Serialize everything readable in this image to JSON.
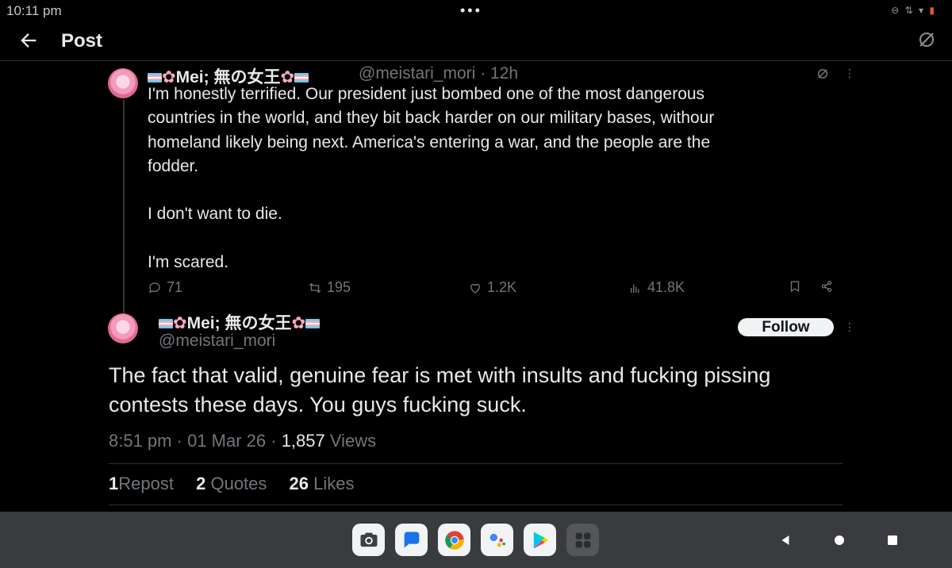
{
  "status_bar": {
    "time": "10:11 pm"
  },
  "header": {
    "title": "Post"
  },
  "reply": {
    "display_name": "Mei; 無の女王",
    "handle": "@meistari_mori",
    "time_ago": "· 12h",
    "text": "I'm honestly terrified. Our president just bombed one of the most dangerous\ncountries in the world, and they bit back harder on our military bases, withour\nhomeland likely being next. America's entering a war, and the people are the\nfodder.\n\nI don't want to die.\n\nI'm scared.",
    "replies": "71",
    "reposts": "195",
    "likes": "1.2K",
    "views": "41.8K"
  },
  "main_post": {
    "display_name": "Mei; 無の女王",
    "handle": "@meistari_mori",
    "follow_label": "Follow",
    "text": "The fact that valid, genuine fear is met with insults and fucking pissing contests these days. You guys fucking suck.",
    "time": "8:51 pm",
    "date": "01 Mar 26",
    "views_count": "1,857",
    "views_label": "Views",
    "reposts_count": "1",
    "reposts_label": "Repost",
    "quotes_count": "2",
    "quotes_label": "Quotes",
    "likes_count": "26",
    "likes_label": "Likes"
  },
  "taskbar_apps": [
    "camera-app",
    "messages-app",
    "chrome-app",
    "assistant-app",
    "play-store-app",
    "app-drawer"
  ],
  "colors": {
    "background": "#000000",
    "text": "#e7e9ea",
    "muted": "#71767b",
    "divider": "#2f3336",
    "navbar": "#3a3b3f"
  }
}
